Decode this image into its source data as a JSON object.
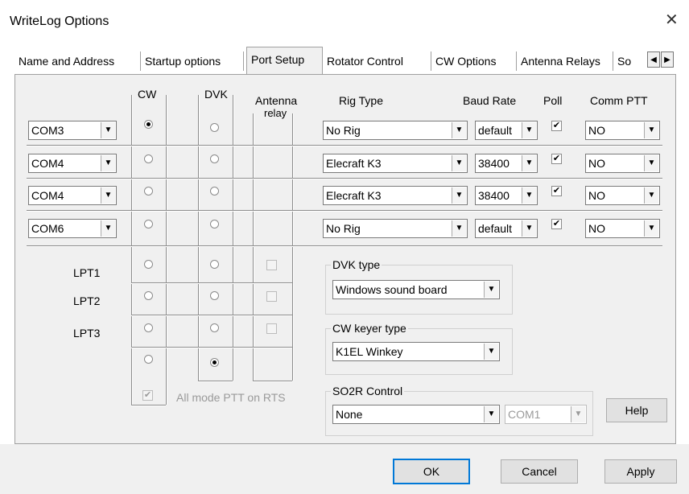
{
  "window": {
    "title": "WriteLog Options",
    "close_glyph": "✕"
  },
  "tabs": [
    {
      "label": "Name and Address"
    },
    {
      "label": "Startup options"
    },
    {
      "label": "Port Setup",
      "active": true
    },
    {
      "label": "Rotator Control"
    },
    {
      "label": "CW Options"
    },
    {
      "label": "Antenna Relays"
    },
    {
      "label": "So"
    }
  ],
  "tab_scroll": {
    "left_icon": "arrow-left-icon",
    "right_icon": "arrow-right-icon"
  },
  "headers": {
    "cw": "CW",
    "dvk": "DVK",
    "antenna": "Antenna",
    "relay": "relay",
    "rig_type": "Rig Type",
    "baud_rate": "Baud Rate",
    "poll": "Poll",
    "comm_ptt": "Comm PTT"
  },
  "com_rows": [
    {
      "port": "COM3",
      "cw": true,
      "dvk": false,
      "rig": "No Rig",
      "baud": "default",
      "poll": true,
      "ptt": "NO"
    },
    {
      "port": "COM4",
      "cw": false,
      "dvk": false,
      "rig": "Elecraft K3",
      "baud": "38400",
      "poll": true,
      "ptt": "NO"
    },
    {
      "port": "COM4",
      "cw": false,
      "dvk": false,
      "rig": "Elecraft K3",
      "baud": "38400",
      "poll": true,
      "ptt": "NO"
    },
    {
      "port": "COM6",
      "cw": false,
      "dvk": false,
      "rig": "No Rig",
      "baud": "default",
      "poll": true,
      "ptt": "NO"
    }
  ],
  "lpt_rows": [
    {
      "label": "LPT1",
      "cw": false,
      "dvk": false,
      "relay": false
    },
    {
      "label": "LPT2",
      "cw": false,
      "dvk": false,
      "relay": false
    },
    {
      "label": "LPT3",
      "cw": false,
      "dvk": false,
      "relay": false
    }
  ],
  "none_row": {
    "cw": false,
    "dvk": true
  },
  "all_mode_ptt": {
    "label": "All mode PTT on RTS",
    "checked": true,
    "disabled": true
  },
  "dvk_type": {
    "label": "DVK type",
    "value": "Windows sound board"
  },
  "cw_keyer": {
    "label": "CW keyer type",
    "value": "K1EL Winkey"
  },
  "so2r": {
    "label": "SO2R Control",
    "value": "None",
    "port": "COM1",
    "port_disabled": true
  },
  "buttons": {
    "help": "Help",
    "ok": "OK",
    "cancel": "Cancel",
    "apply": "Apply"
  },
  "glyphs": {
    "dropdown": "▼",
    "check": "✔"
  }
}
